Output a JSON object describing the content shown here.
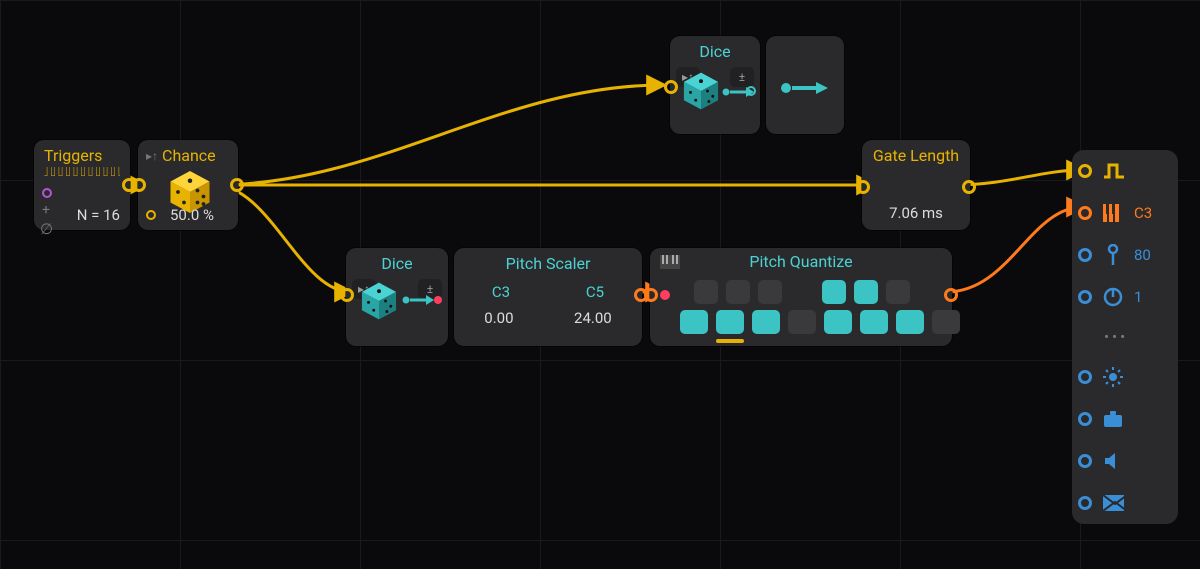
{
  "triggers": {
    "title": "Triggers",
    "N_label": "N = 16"
  },
  "chance": {
    "title": "Chance",
    "value": "50.0 %"
  },
  "dice_top": {
    "title": "Dice"
  },
  "dice_bottom": {
    "title": "Dice"
  },
  "pitch_scaler": {
    "title": "Pitch Scaler",
    "min_note": "C3",
    "max_note": "C5",
    "min_val": "0.00",
    "max_val": "24.00"
  },
  "pitch_quantize": {
    "title": "Pitch Quantize",
    "top_keys": [
      false,
      false,
      false,
      false,
      true,
      true,
      false
    ],
    "bottom_keys": [
      true,
      true,
      true,
      false,
      true,
      true,
      true,
      false
    ]
  },
  "gate_length": {
    "title": "Gate Length",
    "value": "7.06 ms"
  },
  "outputs": {
    "pitch_label": "C3",
    "velocity_label": "80",
    "channel_label": "1"
  },
  "icons": {
    "glue_sort": "glue-sort-icon",
    "plus_minus": "plus-minus-icon"
  }
}
